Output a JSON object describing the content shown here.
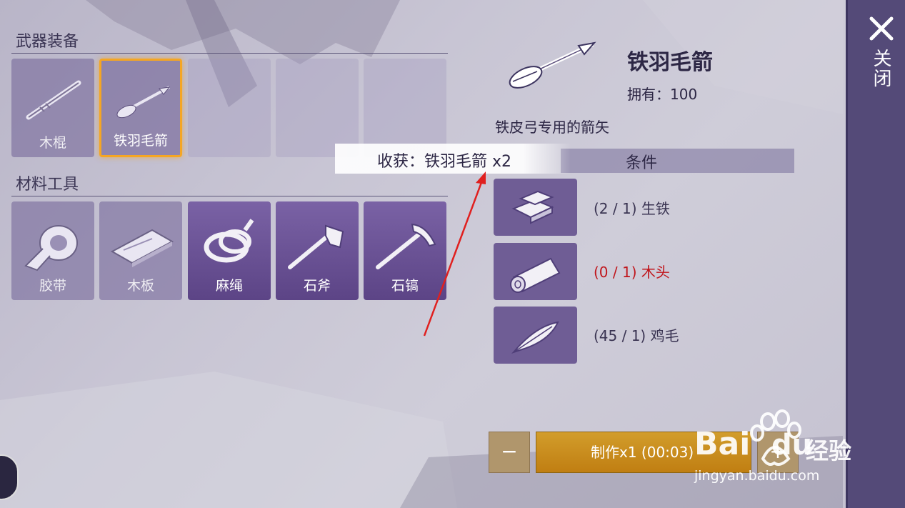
{
  "panel": {
    "weapons_title": "武器装备",
    "materials_title": "材料工具",
    "weapon_slots": [
      {
        "label": "木棍",
        "icon": "stick-icon",
        "state": "dim"
      },
      {
        "label": "铁羽毛箭",
        "icon": "arrow-icon",
        "state": "selected"
      },
      {
        "label": "",
        "icon": "",
        "state": "empty"
      },
      {
        "label": "",
        "icon": "",
        "state": "empty"
      },
      {
        "label": "",
        "icon": "",
        "state": "empty"
      }
    ],
    "material_slots": [
      {
        "label": "胶带",
        "icon": "tape-icon",
        "state": "dim"
      },
      {
        "label": "木板",
        "icon": "plank-icon",
        "state": "dim"
      },
      {
        "label": "麻绳",
        "icon": "rope-icon",
        "state": "on"
      },
      {
        "label": "石斧",
        "icon": "stone-axe-icon",
        "state": "on"
      },
      {
        "label": "石镐",
        "icon": "stone-pickaxe-icon",
        "state": "on"
      }
    ]
  },
  "detail": {
    "name": "铁羽毛箭",
    "owned": "拥有：100",
    "description": "铁皮弓专用的箭矢",
    "harvest": "收获：铁羽毛箭 x2",
    "conditions_title": "条件",
    "requirements": [
      {
        "text": "(2 / 1) 生铁",
        "icon": "iron-ingot-icon",
        "met": true
      },
      {
        "text": "(0 / 1) 木头",
        "icon": "wood-log-icon",
        "met": false
      },
      {
        "text": "(45 / 1) 鸡毛",
        "icon": "feather-icon",
        "met": true
      }
    ]
  },
  "actions": {
    "minus": "−",
    "make": "制作x1 (00:03)",
    "plus": "+"
  },
  "close": {
    "label": "关闭"
  },
  "watermark": {
    "brand": "Bai",
    "brand2": "du",
    "suffix": "经验",
    "url": "jingyan.baidu.com"
  },
  "colors": {
    "selected_border": "#f5a623",
    "shortage_red": "#c0161c",
    "make_button": "#c98a1e",
    "panel_purple": "#6f5d95"
  }
}
